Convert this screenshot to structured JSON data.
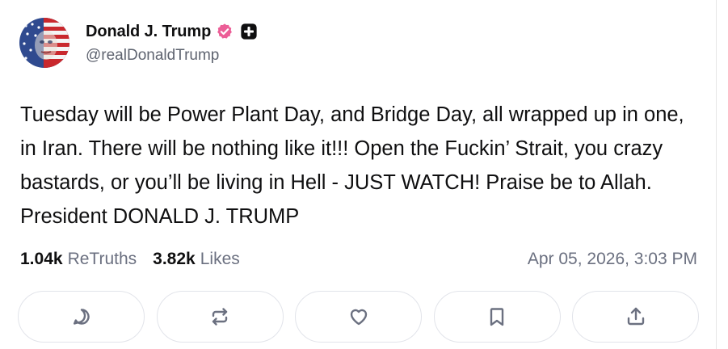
{
  "author": {
    "display_name": "Donald J. Trump",
    "handle": "@realDonaldTrump"
  },
  "post": {
    "text": "Tuesday will be Power Plant Day, and Bridge Day, all wrapped up in one, in Iran. There will be nothing like it!!! Open the Fuckin’ Strait, you crazy bastards, or you’ll be living in Hell - JUST WATCH! Praise be to Allah. President DONALD J. TRUMP"
  },
  "stats": {
    "retruths_count": "1.04k",
    "retruths_label": "ReTruths",
    "likes_count": "3.82k",
    "likes_label": "Likes",
    "timestamp": "Apr 05, 2026, 3:03 PM"
  },
  "actions": [
    {
      "icon": "reply-icon"
    },
    {
      "icon": "retruth-icon"
    },
    {
      "icon": "heart-icon"
    },
    {
      "icon": "bookmark-icon"
    },
    {
      "icon": "share-icon"
    }
  ],
  "colors": {
    "verified_badge": "#ec5e97",
    "muted_text": "#6b7080",
    "button_border": "#e2e4ea",
    "icon": "#6b7080"
  }
}
